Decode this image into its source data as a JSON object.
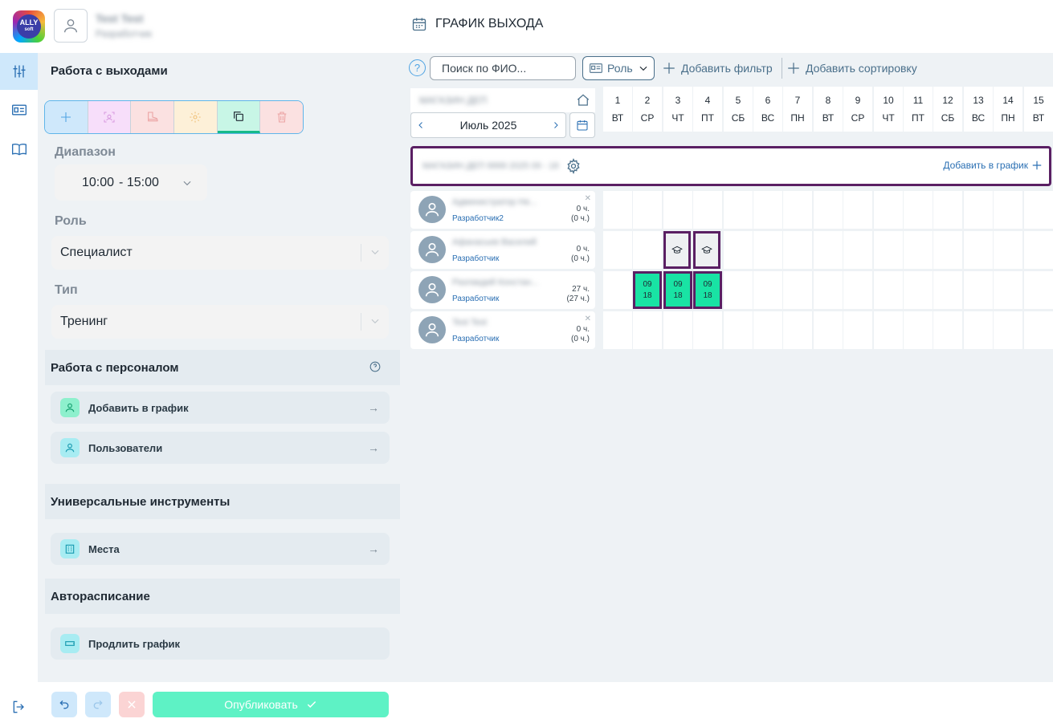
{
  "header": {
    "logo_text": "ALLY",
    "logo_sub": "soft",
    "user_name": "Test Test",
    "user_role": "Разработчик",
    "page_title": "ГРАФИК ВЫХОДА"
  },
  "sidebar": {
    "section_shifts": "Работа с выходами",
    "range_label": "Диапазон",
    "range_from": "10:00",
    "range_to": "- 15:00",
    "role_label": "Роль",
    "role_value": "Специалист",
    "type_label": "Тип",
    "type_value": "Тренинг",
    "section_staff": "Работа с персоналом",
    "add_to_schedule": "Добавить в график",
    "users": "Пользователи",
    "section_tools": "Универсальные инструменты",
    "places": "Места",
    "section_auto": "Авторасписание",
    "extend_schedule": "Продлить график",
    "publish": "Опубликовать"
  },
  "filters": {
    "search_placeholder": "Поиск по ФИО...",
    "role_button": "Роль",
    "add_filter": "Добавить фильтр",
    "add_sort": "Добавить сортировку",
    "help": "?"
  },
  "calendar": {
    "department": "МАГАЗИН ДЕП",
    "month": "Июль 2025",
    "days": [
      {
        "n": "1",
        "d": "ВТ"
      },
      {
        "n": "2",
        "d": "СР"
      },
      {
        "n": "3",
        "d": "ЧТ"
      },
      {
        "n": "4",
        "d": "ПТ"
      },
      {
        "n": "5",
        "d": "СБ"
      },
      {
        "n": "6",
        "d": "ВС"
      },
      {
        "n": "7",
        "d": "ПН"
      },
      {
        "n": "8",
        "d": "ВТ"
      },
      {
        "n": "9",
        "d": "СР"
      },
      {
        "n": "10",
        "d": "ЧТ"
      },
      {
        "n": "11",
        "d": "ПТ"
      },
      {
        "n": "12",
        "d": "СБ"
      },
      {
        "n": "13",
        "d": "ВС"
      },
      {
        "n": "14",
        "d": "ПН"
      },
      {
        "n": "15",
        "d": "ВТ"
      }
    ],
    "group_name": "МАГАЗИН ДЕП 9999 2025 09 - 18",
    "group_add": "Добавить в график"
  },
  "employees": [
    {
      "name": "Администратор Не...",
      "role": "Разработчик2",
      "hours": "0 ч.",
      "hours_sub": "(0 ч.)",
      "removable": true
    },
    {
      "name": "Афанасьев Василий",
      "role": "Разработчик",
      "hours": "0 ч.",
      "hours_sub": "(0 ч.)",
      "removable": false
    },
    {
      "name": "Разлакдий Констан...",
      "role": "Разработчик",
      "hours": "27 ч.",
      "hours_sub": "(27 ч.)",
      "removable": false
    },
    {
      "name": "Test Test",
      "role": "Разработчик",
      "hours": "0 ч.",
      "hours_sub": "(0 ч.)",
      "removable": true
    }
  ],
  "shifts": {
    "start": "09",
    "end": "18",
    "training_days_employee_2": [
      3,
      4
    ],
    "work_days_employee_3": [
      2,
      3,
      4
    ]
  },
  "colors": {
    "accent_purple": "#5a1f63",
    "shift_green": "#19e3a4",
    "publish_green": "#5ef2c5",
    "link_blue": "#2a6fb3"
  }
}
